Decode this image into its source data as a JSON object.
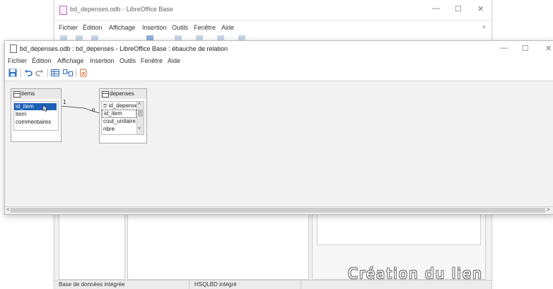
{
  "background_window": {
    "title": "bd_depenses.odb - LibreOffice Base",
    "menu": [
      "Fichier",
      "Édition",
      "Affichage",
      "Insertion",
      "Outils",
      "Fenêtre",
      "Aide"
    ],
    "controls": {
      "minimize": "—",
      "maximize": "☐",
      "close": "✕",
      "doc_close": "×"
    },
    "status": {
      "db_type": "Base de données intégrée",
      "engine": "HSQLBD intégré"
    }
  },
  "foreground_window": {
    "title": "bd_depenses.odb : bd_depenses - LibreOffice Base : ébauche de relation",
    "menu": [
      "Fichier",
      "Édition",
      "Affichage",
      "Insertion",
      "Outils",
      "Fenêtre",
      "Aide"
    ],
    "controls": {
      "minimize": "—",
      "maximize": "☐",
      "close": "✕"
    },
    "toolbar_icons": [
      "save-icon",
      "undo-icon",
      "redo-icon",
      "add-table-icon",
      "new-relation-icon",
      "delete-icon"
    ],
    "hscroll": {
      "left": "<",
      "right": ">"
    }
  },
  "tables": {
    "items": {
      "name": "items",
      "fields": [
        "id_item",
        "item",
        "commentaires"
      ],
      "selected_field": "id_item"
    },
    "depenses": {
      "name": "depenses",
      "fields": [
        "id_depenses",
        "id_item",
        "cout_unitaire",
        "nbre"
      ],
      "key_marker": "⚿",
      "selected_field": "id_item"
    }
  },
  "relation": {
    "from_card": "1",
    "to_card": "n"
  },
  "watermark": "Création du lien",
  "colors": {
    "selection": "#1c5fb7",
    "canvas": "#f2f2f2"
  }
}
